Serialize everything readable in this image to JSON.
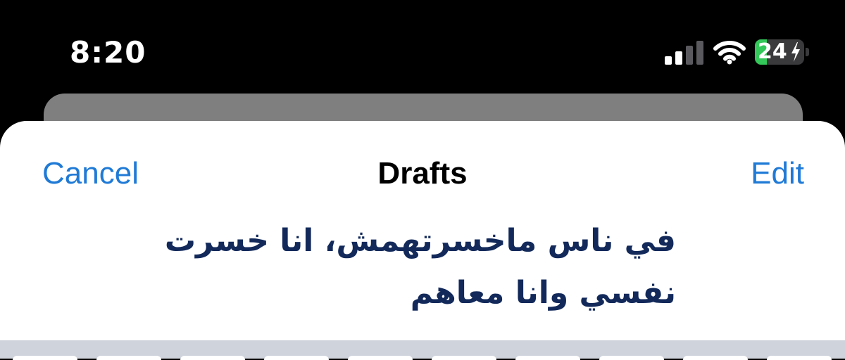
{
  "status_bar": {
    "time": "8:20",
    "signal_icon": "cellular-signal-icon",
    "signal_bars_active": 2,
    "signal_bars_total": 4,
    "wifi_icon": "wifi-icon",
    "battery_icon": "battery-charging-icon",
    "battery_level": "24",
    "battery_percent": 24,
    "battery_color": "#34c759"
  },
  "nav": {
    "cancel_label": "Cancel",
    "title": "Drafts",
    "edit_label": "Edit"
  },
  "draft": {
    "text": "في ناس ماخسرتهمش، انا خسرت نفسي وانا معاهم"
  },
  "colors": {
    "accent": "#1f7ad6",
    "draft_text": "#12295a"
  }
}
